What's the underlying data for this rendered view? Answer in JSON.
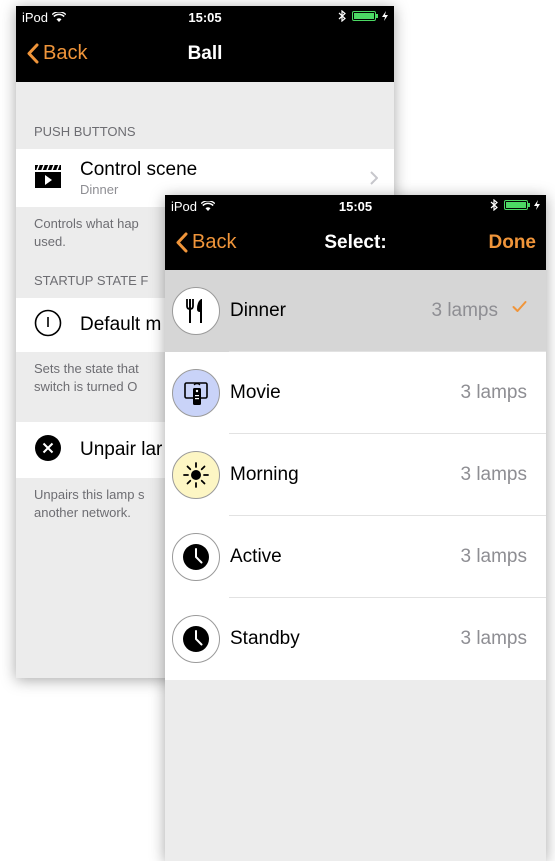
{
  "colors": {
    "accent": "#f0953a",
    "navbar": "#000000",
    "grouped_background": "#ececec",
    "battery": "#4cd964"
  },
  "back_screen": {
    "status_bar": {
      "carrier": "iPod",
      "time": "15:05"
    },
    "nav": {
      "back_label": "Back",
      "title": "Ball"
    },
    "sections": {
      "push_buttons": {
        "header": "PUSH BUTTONS",
        "control_scene": {
          "title": "Control scene",
          "subtitle": "Dinner",
          "icon": "clapperboard-icon"
        },
        "footer": [
          "Controls what hap",
          "used."
        ]
      },
      "startup_state": {
        "header": "STARTUP STATE F",
        "default": {
          "title": "Default m",
          "icon": "power-icon"
        },
        "footer": [
          "Sets the state that",
          "switch is turned O"
        ]
      },
      "unpair": {
        "cell": {
          "title": "Unpair lar",
          "icon": "close-circle-icon"
        },
        "footer": [
          "Unpairs this lamp s",
          "another network."
        ]
      }
    }
  },
  "front_screen": {
    "status_bar": {
      "carrier": "iPod",
      "time": "15:05"
    },
    "nav": {
      "back_label": "Back",
      "title": "Select:",
      "done_label": "Done"
    },
    "scenes": [
      {
        "name": "Dinner",
        "count": "3 lamps",
        "icon": "fork-knife-icon",
        "selected": true,
        "icon_bg": "#ffffff"
      },
      {
        "name": "Movie",
        "count": "3 lamps",
        "icon": "remote-tv-icon",
        "selected": false,
        "icon_bg": "#c9d3f8"
      },
      {
        "name": "Morning",
        "count": "3 lamps",
        "icon": "sun-icon",
        "selected": false,
        "icon_bg": "#fdf6c4"
      },
      {
        "name": "Active",
        "count": "3 lamps",
        "icon": "clock-icon",
        "selected": false,
        "icon_bg": "#ffffff"
      },
      {
        "name": "Standby",
        "count": "3 lamps",
        "icon": "clock-icon",
        "selected": false,
        "icon_bg": "#ffffff"
      }
    ]
  }
}
